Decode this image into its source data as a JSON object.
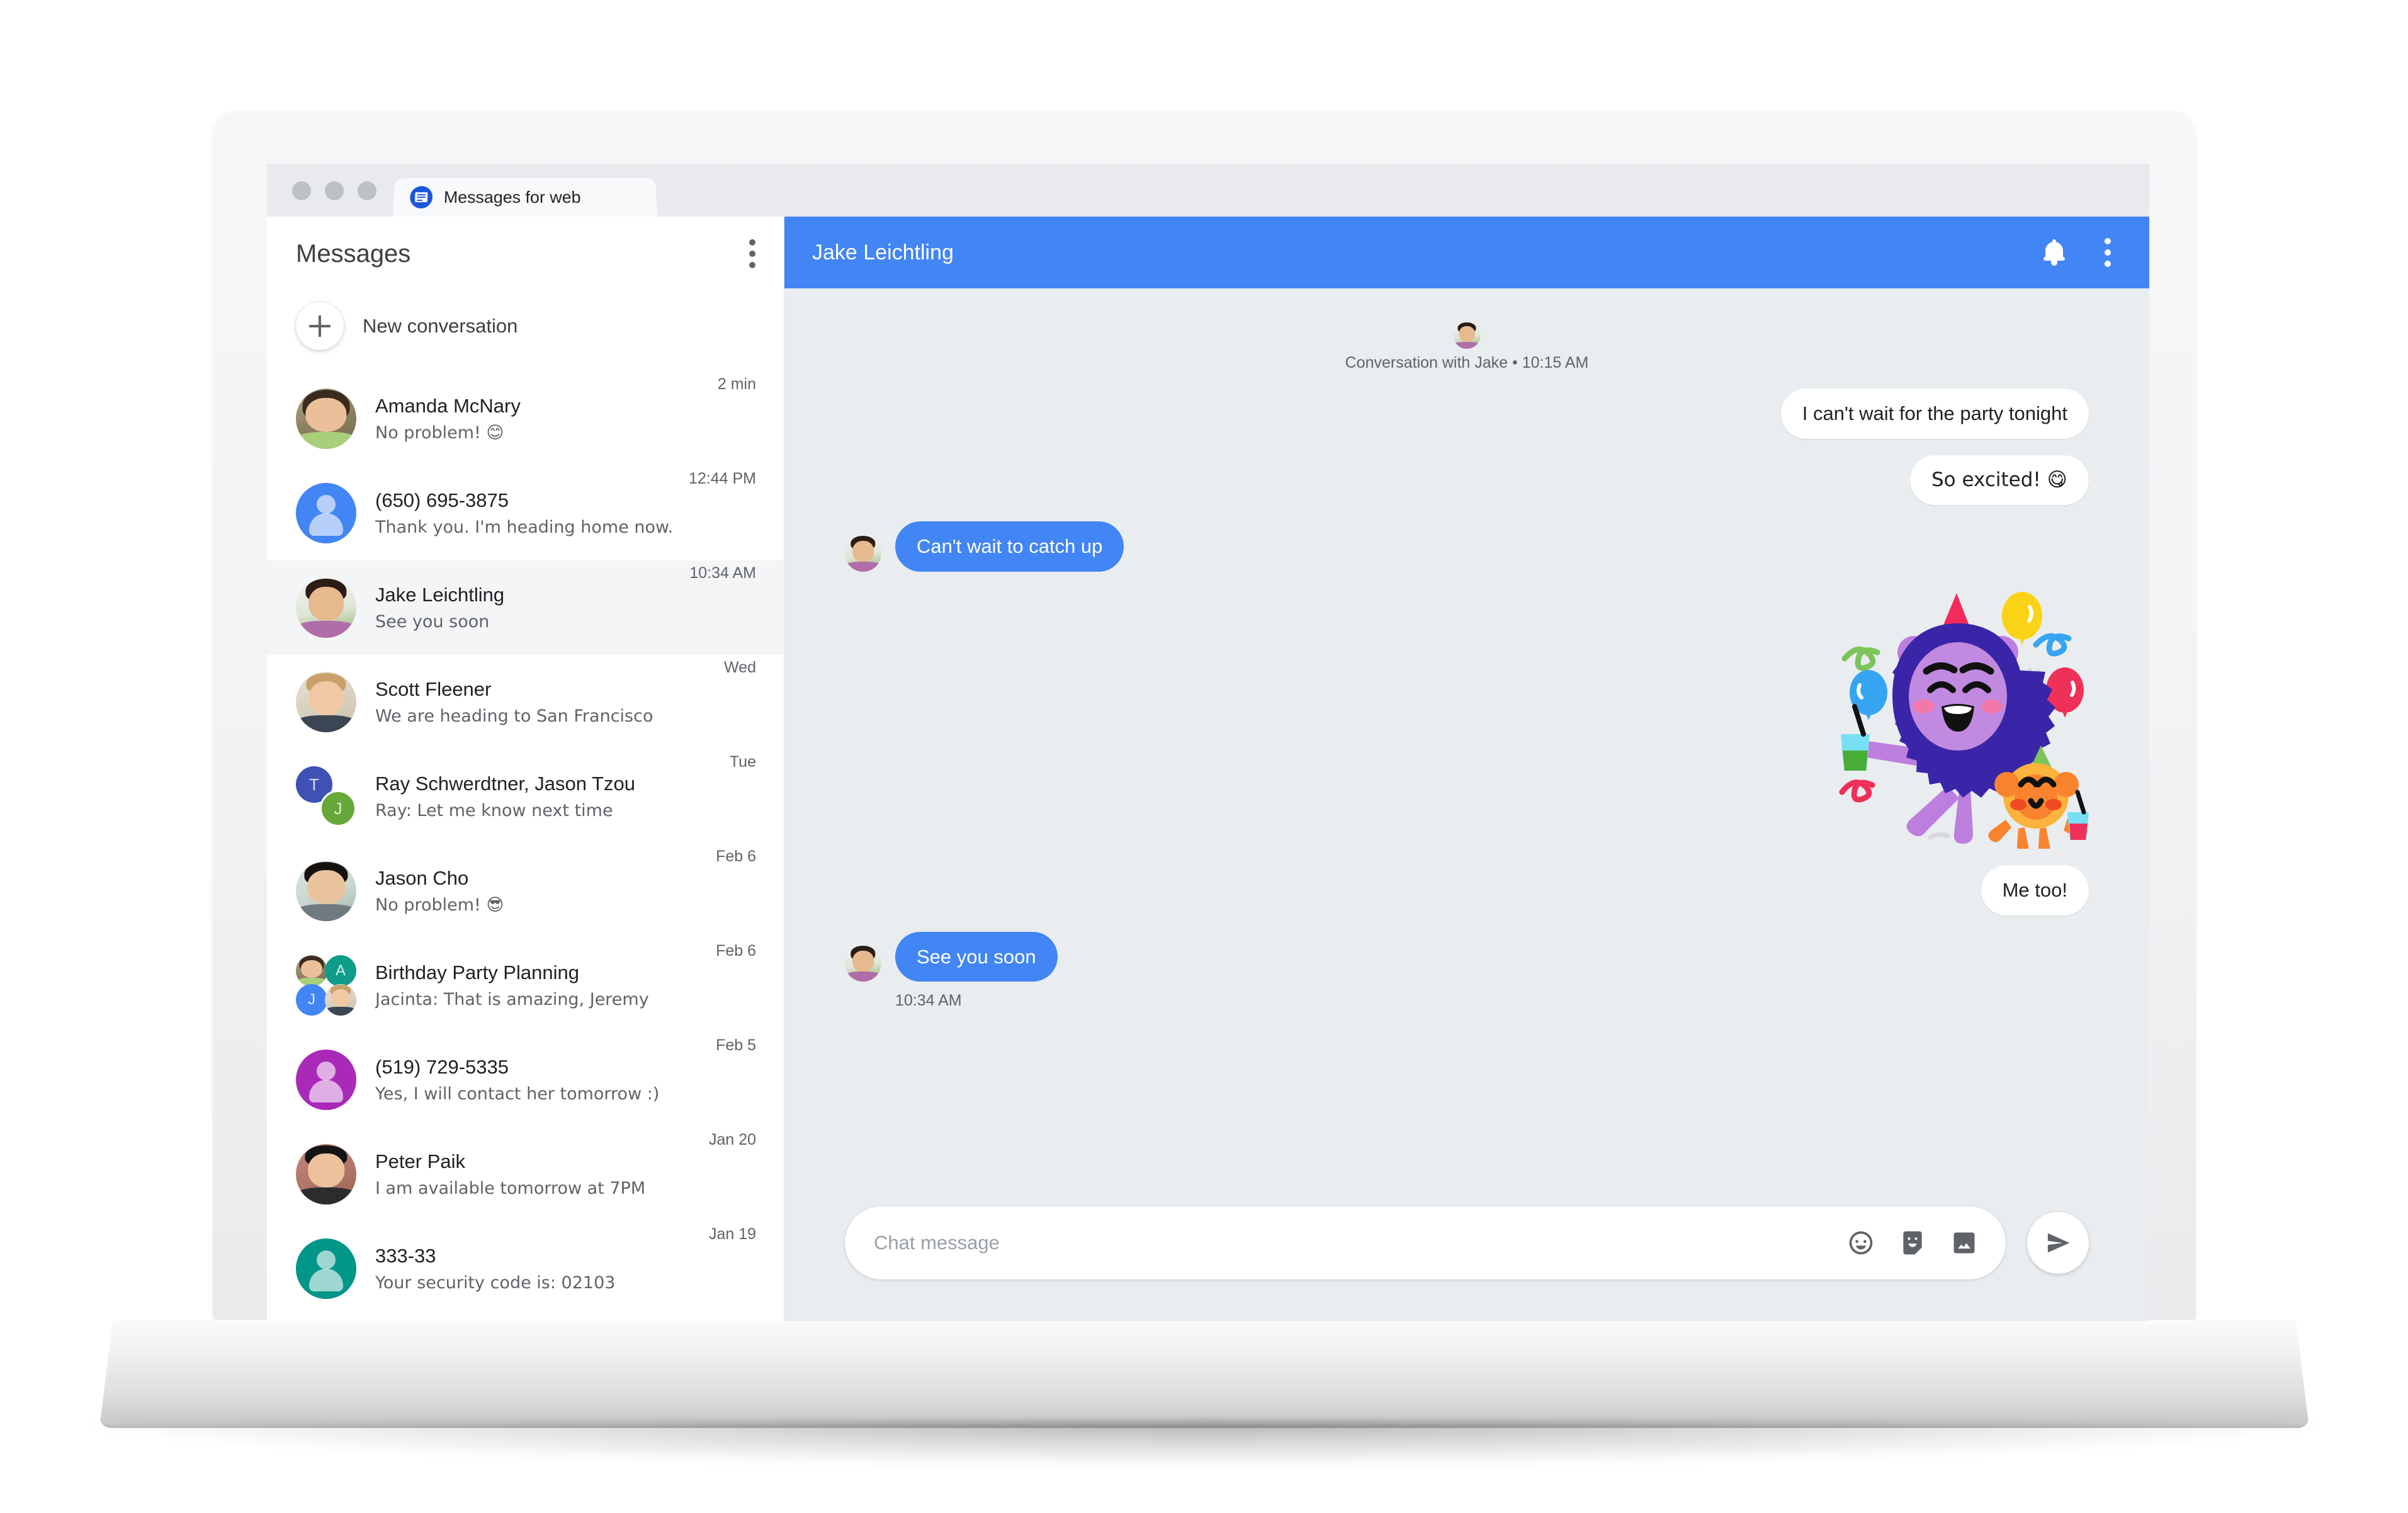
{
  "browser": {
    "tab_title": "Messages for web",
    "favicon": "messages-favicon"
  },
  "sidebar": {
    "title": "Messages",
    "menu_icon": "kebab-menu-icon",
    "new_conversation": {
      "label": "New conversation",
      "icon": "plus-icon"
    },
    "conversations": [
      {
        "name": "Amanda McNary",
        "snippet": "No problem! 😊",
        "time": "2 min",
        "avatar": "photo-amanda",
        "active": false
      },
      {
        "name": "(650) 695-3875",
        "snippet": "Thank you. I'm heading home now.",
        "time": "12:44 PM",
        "avatar": "generic-person-blue",
        "color": "#4285f4",
        "active": false
      },
      {
        "name": "Jake Leichtling",
        "snippet": "See you soon",
        "time": "10:34 AM",
        "avatar": "photo-jake",
        "active": true
      },
      {
        "name": "Scott Fleener",
        "snippet": "We are heading to San Francisco",
        "time": "Wed",
        "avatar": "photo-scott",
        "active": false
      },
      {
        "name": "Ray Schwerdtner, Jason Tzou",
        "snippet": "Ray: Let me know next time",
        "time": "Tue",
        "avatar": "pair-initials",
        "initials": [
          "T",
          "J"
        ],
        "colors": [
          "#3f51b5",
          "#66a93a"
        ],
        "active": false
      },
      {
        "name": "Jason Cho",
        "snippet": "No problem! 😎",
        "time": "Feb 6",
        "avatar": "photo-jason",
        "active": false
      },
      {
        "name": "Birthday Party Planning",
        "snippet": "Jacinta: That is amazing, Jeremy",
        "time": "Feb 6",
        "avatar": "group-quad",
        "initials": [
          "A",
          "J"
        ],
        "colors": [
          "#0f9d8a",
          "#4285f4"
        ],
        "active": false
      },
      {
        "name": "(519) 729-5335",
        "snippet": "Yes, I will contact her tomorrow :)",
        "time": "Feb 5",
        "avatar": "generic-person-purple",
        "color": "#aa2ab8",
        "active": false
      },
      {
        "name": "Peter Paik",
        "snippet": "I am available tomorrow at 7PM",
        "time": "Jan 20",
        "avatar": "photo-peter",
        "active": false
      },
      {
        "name": "333-33",
        "snippet": "Your security code is: 02103",
        "time": "Jan 19",
        "avatar": "generic-person-teal",
        "color": "#009688",
        "active": false
      }
    ]
  },
  "chat": {
    "header": {
      "title": "Jake Leichtling",
      "notification_icon": "bell-icon",
      "menu_icon": "kebab-menu-icon",
      "background_color": "#4285f4"
    },
    "conversation_start": {
      "label": "Conversation with Jake • 10:15 AM",
      "avatar": "photo-jake"
    },
    "messages": [
      {
        "id": "m1",
        "direction": "out",
        "text": "I can't wait for the party tonight",
        "style": "white"
      },
      {
        "id": "m2",
        "direction": "out",
        "text": "So excited! 😋",
        "style": "white"
      },
      {
        "id": "m3",
        "direction": "in",
        "text": "Can't wait to catch up",
        "style": "blue",
        "avatar": "photo-jake"
      },
      {
        "id": "m4",
        "direction": "out",
        "text": "",
        "style": "sticker",
        "sticker": "party-monster-sticker"
      },
      {
        "id": "m5",
        "direction": "out",
        "text": "Me too!",
        "style": "white"
      },
      {
        "id": "m6",
        "direction": "in",
        "text": "See you soon",
        "style": "blue",
        "avatar": "photo-jake",
        "timestamp": "10:34 AM"
      }
    ],
    "composer": {
      "placeholder": "Chat message",
      "value": "",
      "emoji_icon": "emoji-icon",
      "sticker_icon": "sticker-icon",
      "image_icon": "image-icon",
      "send_icon": "send-icon"
    }
  },
  "colors": {
    "accent": "#4285f4",
    "chat_background": "#e9edf0",
    "active_row": "#f4f5f6"
  }
}
